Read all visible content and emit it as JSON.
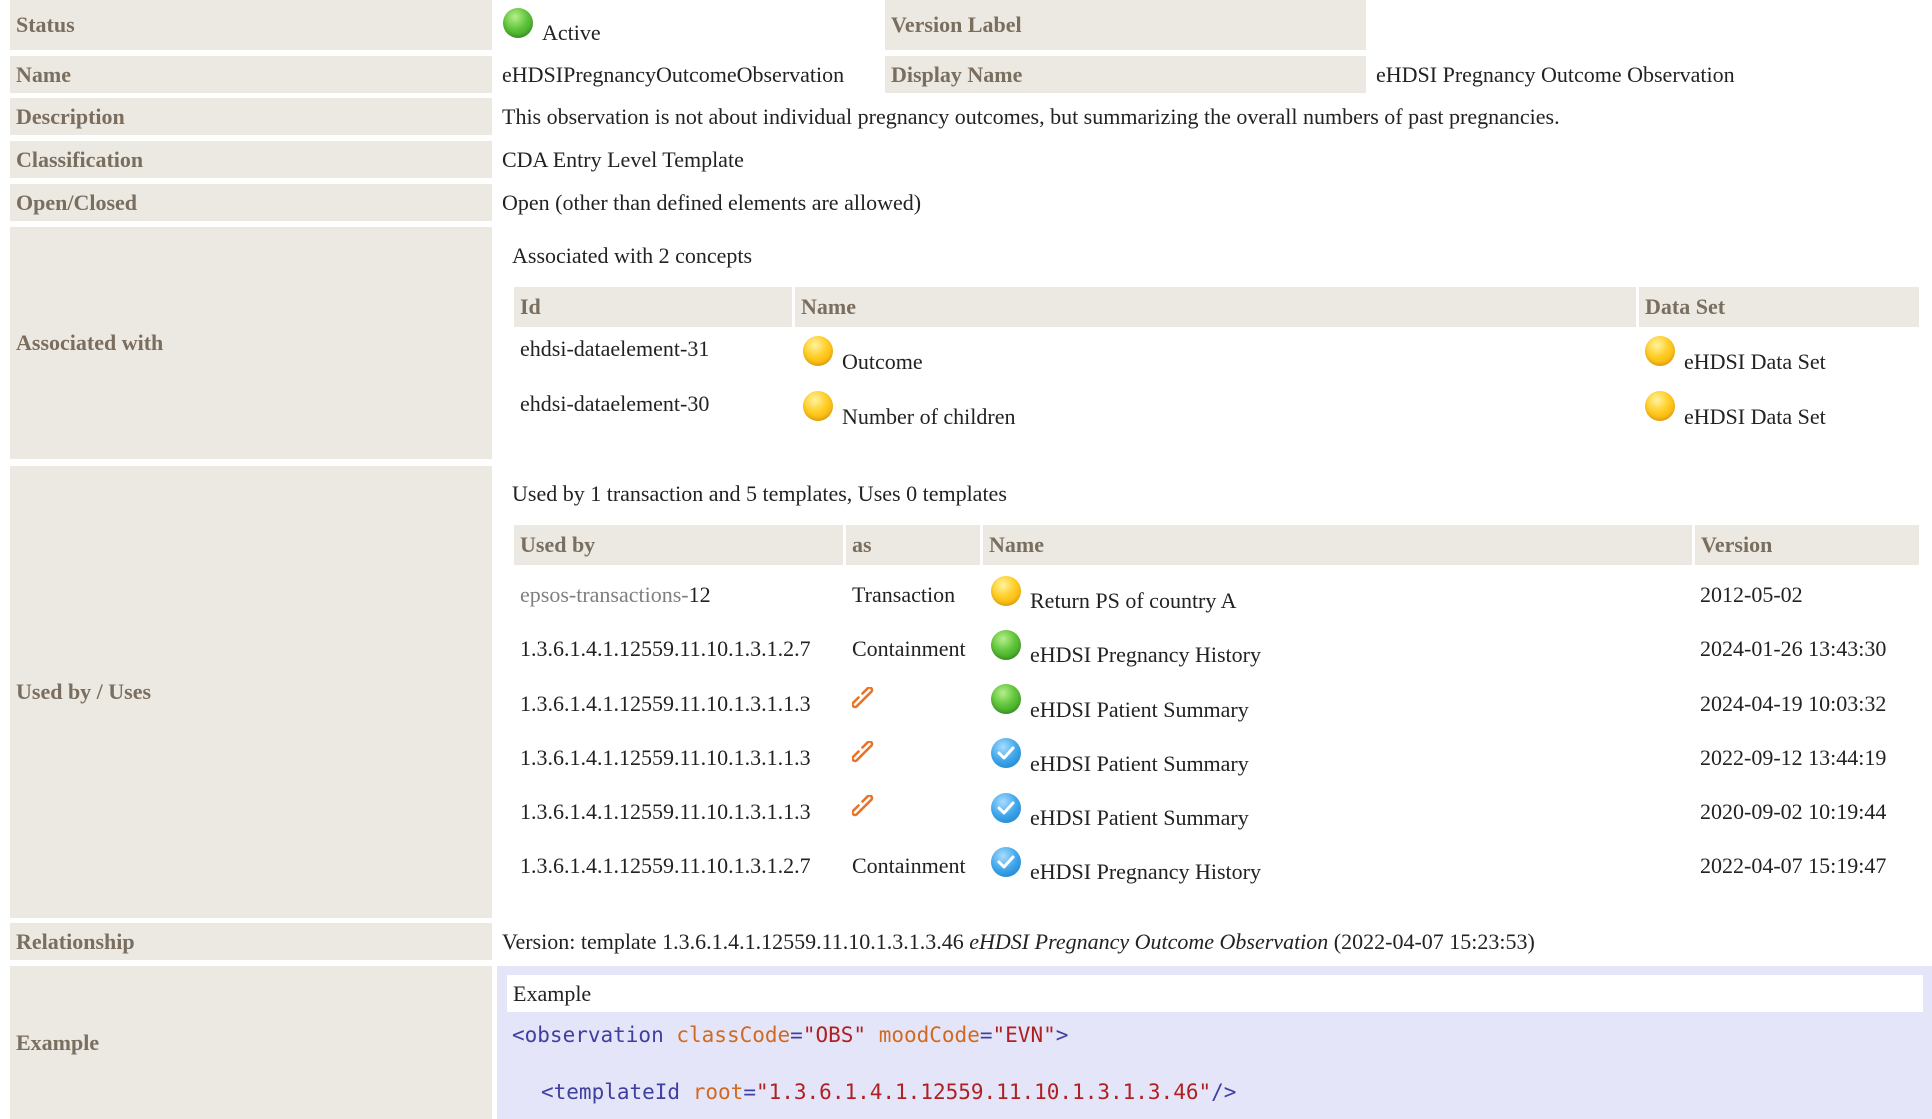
{
  "status": {
    "label": "Status",
    "value": "Active",
    "version_label": "Version Label"
  },
  "name": {
    "label": "Name",
    "value": "eHDSIPregnancyOutcomeObservation",
    "display_name_label": "Display Name",
    "display_name_value": "eHDSI Pregnancy Outcome Observation"
  },
  "description": {
    "label": "Description",
    "value": "This observation is not about individual pregnancy outcomes, but summarizing the overall numbers of past pregnancies."
  },
  "classification": {
    "label": "Classification",
    "value": "CDA Entry Level Template"
  },
  "open_closed": {
    "label": "Open/Closed",
    "value": "Open (other than defined elements are allowed)"
  },
  "associated": {
    "label": "Associated with",
    "summary": "Associated with 2 concepts",
    "headers": [
      "Id",
      "Name",
      "Data Set"
    ],
    "rows": [
      {
        "id": "ehdsi-dataelement-31",
        "name": "Outcome",
        "dataset": "eHDSI Data Set"
      },
      {
        "id": "ehdsi-dataelement-30",
        "name": "Number of children",
        "dataset": "eHDSI Data Set"
      }
    ]
  },
  "used_by": {
    "label": "Used by / Uses",
    "summary": "Used by 1 transaction and 5 templates, Uses 0 templates",
    "headers": [
      "Used by",
      "as",
      "Name",
      "Version"
    ],
    "rows": [
      {
        "used_by_prefix": "epsos-transactions-",
        "used_by": "12",
        "as": "Transaction",
        "status": "draft",
        "name": "Return PS of country A",
        "version": "2012-05-02"
      },
      {
        "used_by_prefix": "",
        "used_by": "1.3.6.1.4.1.12559.11.10.1.3.1.2.7",
        "as": "Containment",
        "status": "active",
        "name": "eHDSI Pregnancy History",
        "version": "2024-01-26 13:43:30"
      },
      {
        "used_by_prefix": "",
        "used_by": "1.3.6.1.4.1.12559.11.10.1.3.1.1.3",
        "as": "",
        "as_icon": "link-icon",
        "status": "active",
        "name": "eHDSI Patient Summary",
        "version": "2024-04-19 10:03:32"
      },
      {
        "used_by_prefix": "",
        "used_by": "1.3.6.1.4.1.12559.11.10.1.3.1.1.3",
        "as": "",
        "as_icon": "link-icon",
        "status": "final",
        "name": "eHDSI Patient Summary",
        "version": "2022-09-12 13:44:19"
      },
      {
        "used_by_prefix": "",
        "used_by": "1.3.6.1.4.1.12559.11.10.1.3.1.1.3",
        "as": "",
        "as_icon": "link-icon",
        "status": "final",
        "name": "eHDSI Patient Summary",
        "version": "2020-09-02 10:19:44"
      },
      {
        "used_by_prefix": "",
        "used_by": "1.3.6.1.4.1.12559.11.10.1.3.1.2.7",
        "as": "Containment",
        "status": "final",
        "name": "eHDSI Pregnancy History",
        "version": "2022-04-07 15:19:47"
      }
    ]
  },
  "relationship": {
    "label": "Relationship",
    "prefix": "Version: template 1.3.6.1.4.1.12559.11.10.1.3.1.3.46 ",
    "title": "eHDSI Pregnancy Outcome Observation",
    "suffix": " (2022-04-07 15:23:53)"
  },
  "example": {
    "label": "Example",
    "title": "Example",
    "line1": {
      "open": "<observation",
      "attr1": "classCode",
      "eq1": "=",
      "val1": "\"OBS\"",
      "attr2": "moodCode",
      "eq2": "=",
      "val2": "\"EVN\"",
      "close": ">"
    },
    "line2": {
      "open": "<templateId",
      "attr1": "root",
      "eq1": "=",
      "val1": "\"1.3.6.1.4.1.12559.11.10.1.3.1.3.46\"",
      "close": "/>"
    }
  },
  "colors": {
    "label_bg": "#ece9e3",
    "label_text": "#7a6e5f",
    "example_bg": "#e4e5f8",
    "status_active": "#5fc43a",
    "status_draft": "#ffcc22",
    "status_final": "#3ea6ea"
  }
}
